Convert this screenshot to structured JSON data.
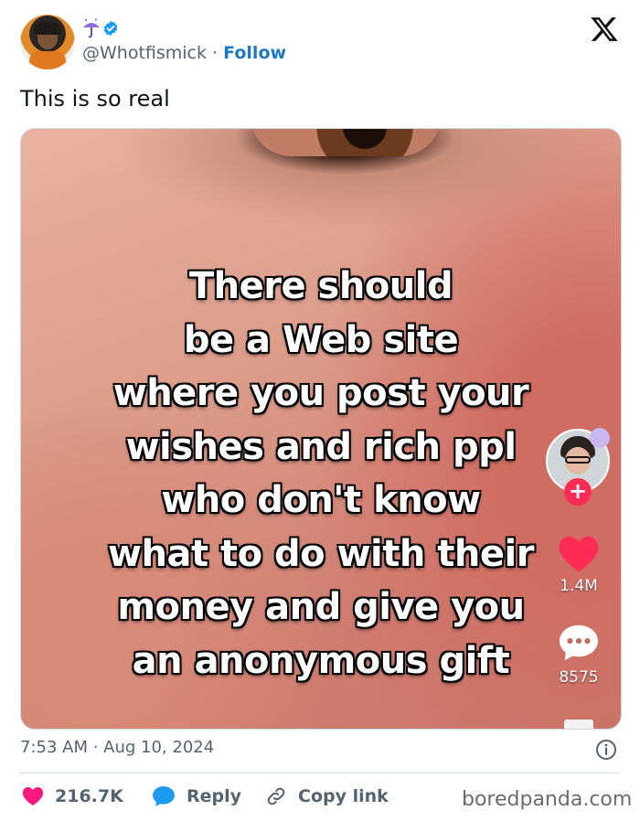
{
  "author": {
    "handle": "@Whotfismick",
    "separator": "·",
    "follow_label": "Follow",
    "emoji_icon": "umbrella-with-rain-icon",
    "verified_icon": "verified-badge-icon",
    "verified_color": "#1d9bf0"
  },
  "tweet": {
    "text": "This is so real",
    "timestamp": "7:53 AM · Aug 10, 2024"
  },
  "video": {
    "overlay_lines": [
      "There should",
      "be a Web site",
      "where you post your",
      "wishes and rich ppl",
      "who don't know",
      "what to do with their",
      "money and give you",
      "an anonymous gift"
    ],
    "like_count": "1.4M",
    "comment_count": "8575",
    "plus_label": "+"
  },
  "actions": {
    "likes": "216.7K",
    "reply_label": "Reply",
    "copy_link_label": "Copy link"
  },
  "watermark": "boredpanda.com",
  "colors": {
    "accent": "#1d78c6",
    "like_red": "#f91880",
    "tiktok_red": "#fe2c55",
    "reply_blue": "#1d9bf0",
    "text_secondary": "#536471"
  }
}
